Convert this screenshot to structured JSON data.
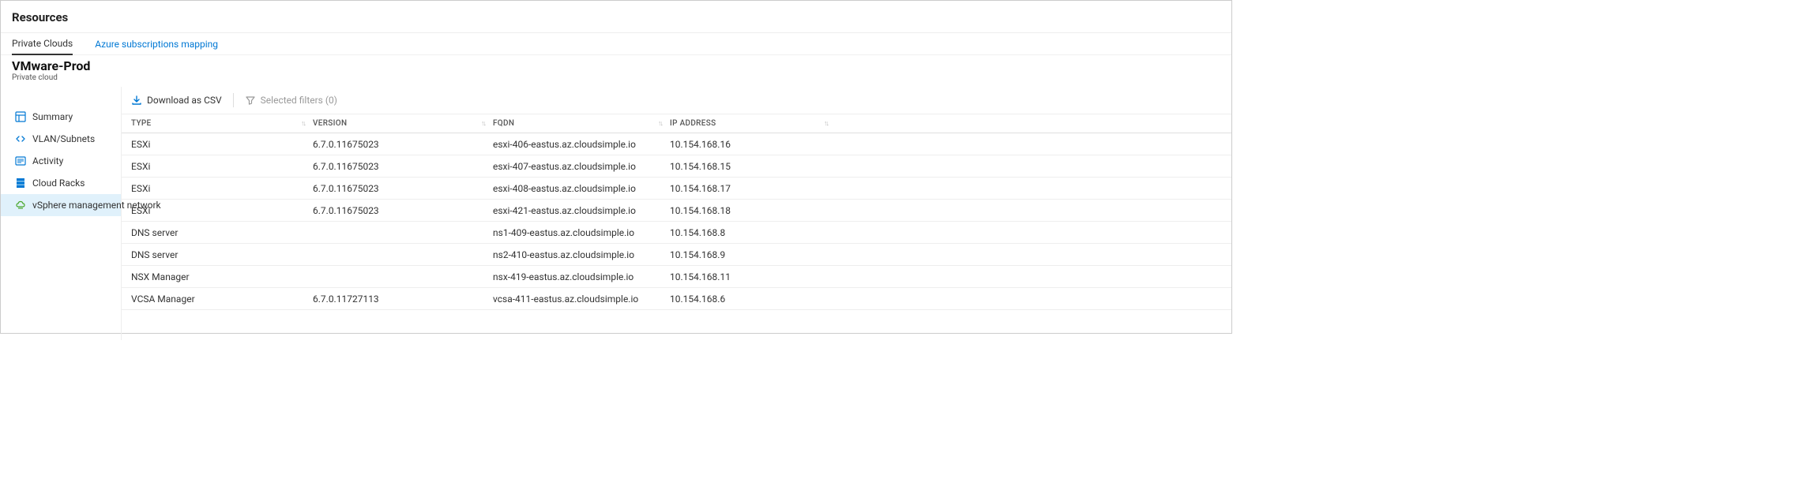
{
  "header": {
    "title": "Resources"
  },
  "tabs": [
    {
      "label": "Private Clouds",
      "active": true
    },
    {
      "label": "Azure subscriptions mapping",
      "active": false
    }
  ],
  "cloud": {
    "name": "VMware-Prod",
    "subtitle": "Private cloud"
  },
  "sidebar": {
    "items": [
      {
        "label": "Summary",
        "icon": "summary"
      },
      {
        "label": "VLAN/Subnets",
        "icon": "vlan"
      },
      {
        "label": "Activity",
        "icon": "activity"
      },
      {
        "label": "Cloud Racks",
        "icon": "racks"
      },
      {
        "label": "vSphere management network",
        "icon": "vsphere",
        "active": true
      }
    ]
  },
  "toolbar": {
    "download_label": "Download as CSV",
    "filter_label": "Selected filters (0)"
  },
  "table": {
    "columns": [
      {
        "label": "TYPE"
      },
      {
        "label": "VERSION"
      },
      {
        "label": "FQDN"
      },
      {
        "label": "IP ADDRESS"
      }
    ],
    "rows": [
      {
        "type": "ESXi",
        "version": "6.7.0.11675023",
        "fqdn": "esxi-406-eastus.az.cloudsimple.io",
        "ip": "10.154.168.16"
      },
      {
        "type": "ESXi",
        "version": "6.7.0.11675023",
        "fqdn": "esxi-407-eastus.az.cloudsimple.io",
        "ip": "10.154.168.15"
      },
      {
        "type": "ESXi",
        "version": "6.7.0.11675023",
        "fqdn": "esxi-408-eastus.az.cloudsimple.io",
        "ip": "10.154.168.17"
      },
      {
        "type": "ESXi",
        "version": "6.7.0.11675023",
        "fqdn": "esxi-421-eastus.az.cloudsimple.io",
        "ip": "10.154.168.18"
      },
      {
        "type": "DNS server",
        "version": "",
        "fqdn": "ns1-409-eastus.az.cloudsimple.io",
        "ip": "10.154.168.8"
      },
      {
        "type": "DNS server",
        "version": "",
        "fqdn": "ns2-410-eastus.az.cloudsimple.io",
        "ip": "10.154.168.9"
      },
      {
        "type": "NSX Manager",
        "version": "",
        "fqdn": "nsx-419-eastus.az.cloudsimple.io",
        "ip": "10.154.168.11"
      },
      {
        "type": "VCSA Manager",
        "version": "6.7.0.11727113",
        "fqdn": "vcsa-411-eastus.az.cloudsimple.io",
        "ip": "10.154.168.6"
      }
    ]
  }
}
